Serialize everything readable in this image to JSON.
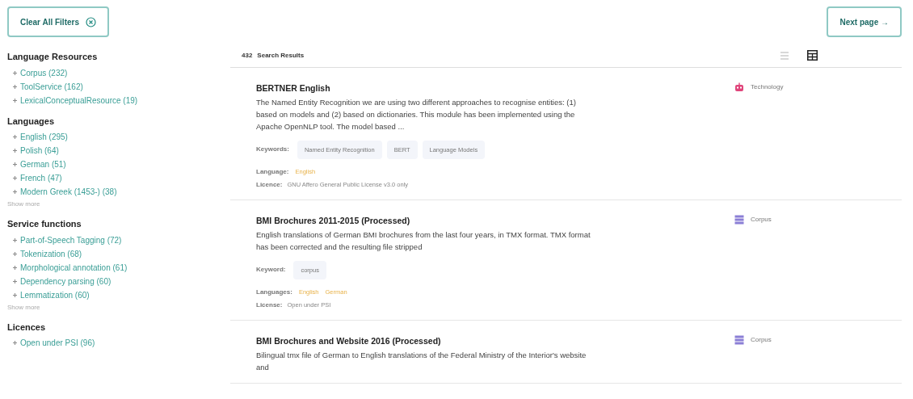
{
  "clear_button": {
    "label": "Clear All Filters"
  },
  "next_button": {
    "label": "Next page →"
  },
  "filters": [
    {
      "title": "Language Resources",
      "items": [
        "Corpus (232)",
        "ToolService (162)",
        "LexicalConceptualResource (19)"
      ]
    },
    {
      "title": "Languages",
      "items": [
        "English (295)",
        "Polish (64)",
        "German (51)",
        "French (47)",
        "Modern Greek (1453-) (38)"
      ],
      "show_more": "Show more"
    },
    {
      "title": "Service functions",
      "items": [
        "Part-of-Speech Tagging (72)",
        "Tokenization (68)",
        "Morphological annotation (61)",
        "Dependency parsing (60)",
        "Lemmatization (60)"
      ],
      "show_more": "Show more"
    },
    {
      "title": "Licences",
      "items": [
        "Open under PSI (96)"
      ]
    }
  ],
  "results_header": {
    "count": "432",
    "label": "Search Results",
    "views": [
      {
        "kind": "list",
        "selected": false
      },
      {
        "kind": "grid",
        "selected": true
      }
    ]
  },
  "results": [
    {
      "title": "BERTNER English",
      "description": "The Named Entity Recognition we are using two different approaches to recognise entities: (1) based on models and (2) based on dictionaries. This module has been implemented using the Apache OpenNLP tool. The model based ...",
      "keywords_label": "Keywords:",
      "keywords": [
        "Named Entity Recognition",
        "BERT",
        "Language Models"
      ],
      "languages_label": "Language:",
      "languages": [
        "English"
      ],
      "licence_label": "Licence:",
      "licence": "GNU Affero General Public License v3.0 only",
      "type": {
        "kind": "technology",
        "label": "Technology",
        "color": "#e0457b"
      }
    },
    {
      "title": "BMI Brochures 2011-2015 (Processed)",
      "description": "English translations of German BMI brochures from the last four years, in TMX format. TMX format has been corrected and the resulting file stripped",
      "keywords_label": "Keyword:",
      "keywords": [
        "corpus"
      ],
      "languages_label": "Languages:",
      "languages": [
        "English",
        "German"
      ],
      "licence_label": "License:",
      "licence": "Open under PSI",
      "type": {
        "kind": "corpus",
        "label": "Corpus",
        "color": "#8b7fd6"
      }
    },
    {
      "title": "BMI Brochures and Website 2016 (Processed)",
      "description": "Bilingual tmx file of German to English translations of the Federal Ministry of the Interior's website and",
      "type": {
        "kind": "corpus",
        "label": "Corpus",
        "color": "#8b7fd6"
      }
    }
  ]
}
